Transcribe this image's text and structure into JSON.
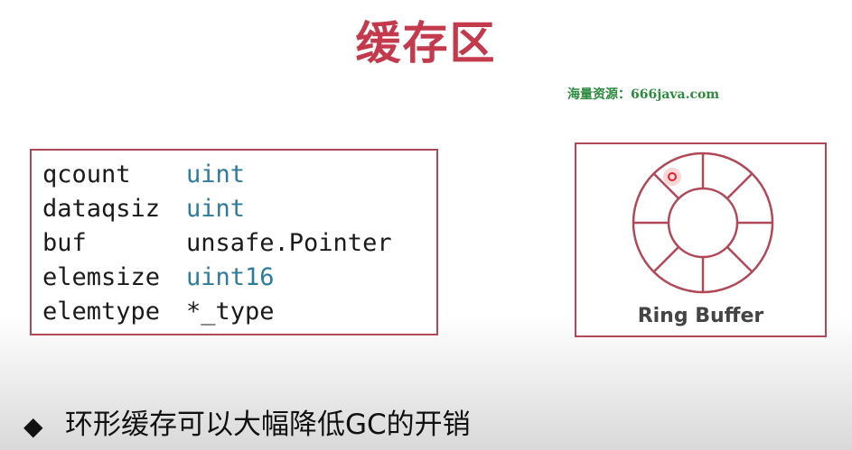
{
  "slide": {
    "title": "缓存区",
    "watermark": "海量资源：666java.com",
    "struct_fields": [
      {
        "name": "qcount",
        "type": "uint",
        "type_kind": "keyword"
      },
      {
        "name": "dataqsiz",
        "type": "uint",
        "type_kind": "keyword"
      },
      {
        "name": "buf",
        "type": "unsafe.Pointer",
        "type_kind": "plain"
      },
      {
        "name": "elemsize",
        "type": "uint16",
        "type_kind": "keyword"
      },
      {
        "name": "elemtype",
        "type": "*_type",
        "type_kind": "plain"
      }
    ],
    "ring_label": "Ring Buffer",
    "ring_segments": 8,
    "bullet_symbol": "◆",
    "bullet_text": "环形缓存可以大幅降低GC的开销"
  },
  "colors": {
    "title": "#c43a4d",
    "border": "#b04858",
    "type_keyword": "#2e7b9b",
    "watermark": "#2d8a3e",
    "cursor_dot": "#e0202a"
  }
}
